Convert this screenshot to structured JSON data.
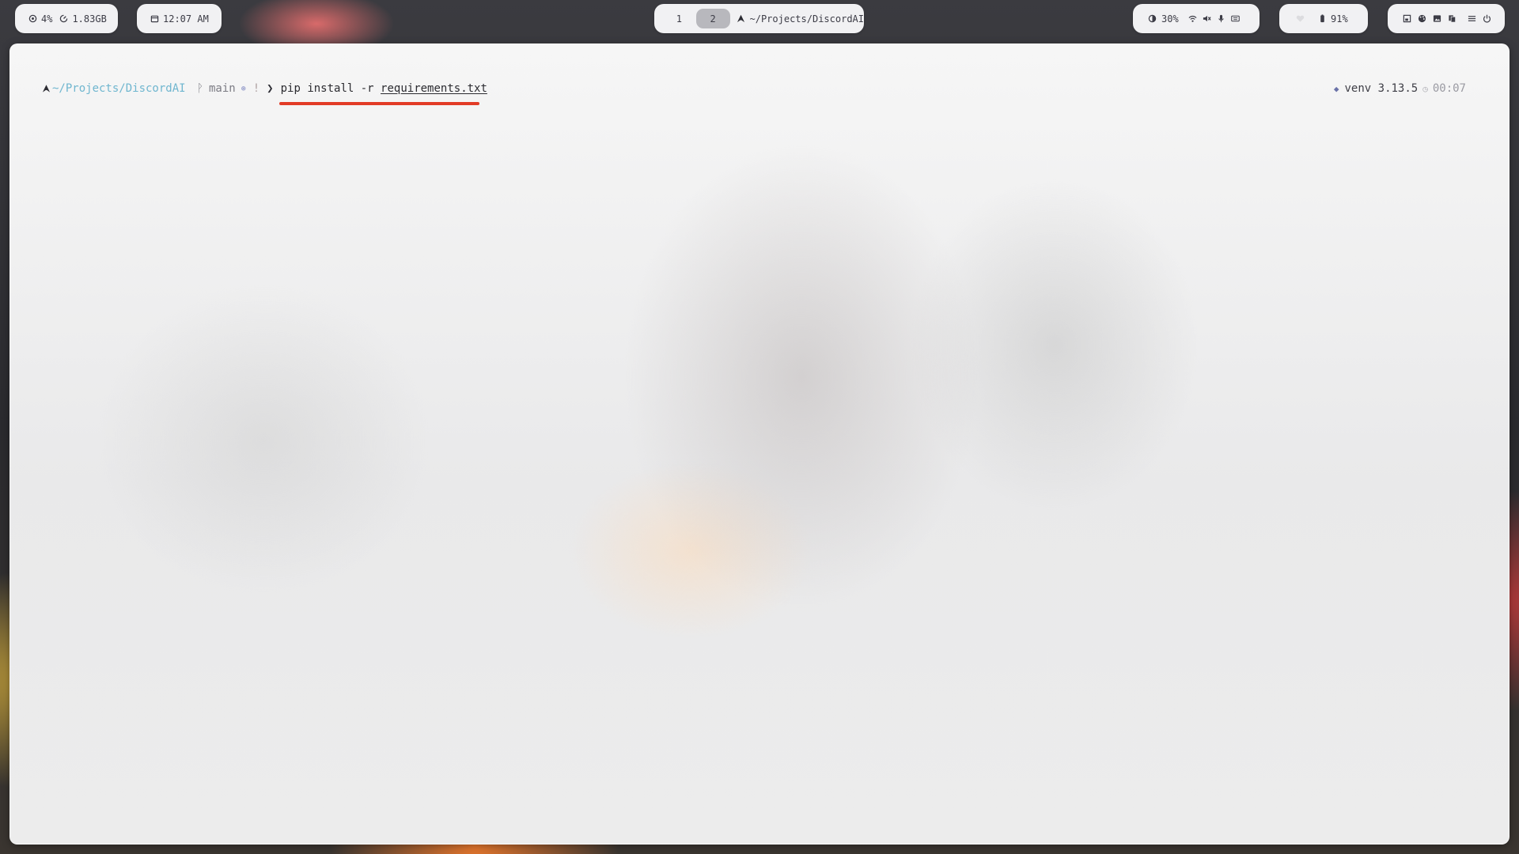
{
  "topbar": {
    "stats": {
      "cpu": "4%",
      "memory": "1.83GB"
    },
    "clock": {
      "time": "12:07 AM"
    },
    "workspaces": {
      "items": [
        {
          "label": "1"
        },
        {
          "label": "2"
        }
      ],
      "active": "2",
      "window_title": "~/Projects/DiscordAI"
    },
    "system": {
      "brightness": "30%"
    },
    "battery": {
      "level": "91%"
    }
  },
  "terminal": {
    "prompt": {
      "cwd": "~/Projects/DiscordAI",
      "branch": "main",
      "dirty": "!",
      "command": "pip install -r ",
      "argument": "requirements.txt"
    },
    "right_prompt": {
      "venv": "venv 3.13.5",
      "duration": "00:07"
    }
  },
  "colors": {
    "cwd": "#6fb6cf",
    "highlight_underline": "#e23b26",
    "active_workspace": "#b8b8bd"
  }
}
